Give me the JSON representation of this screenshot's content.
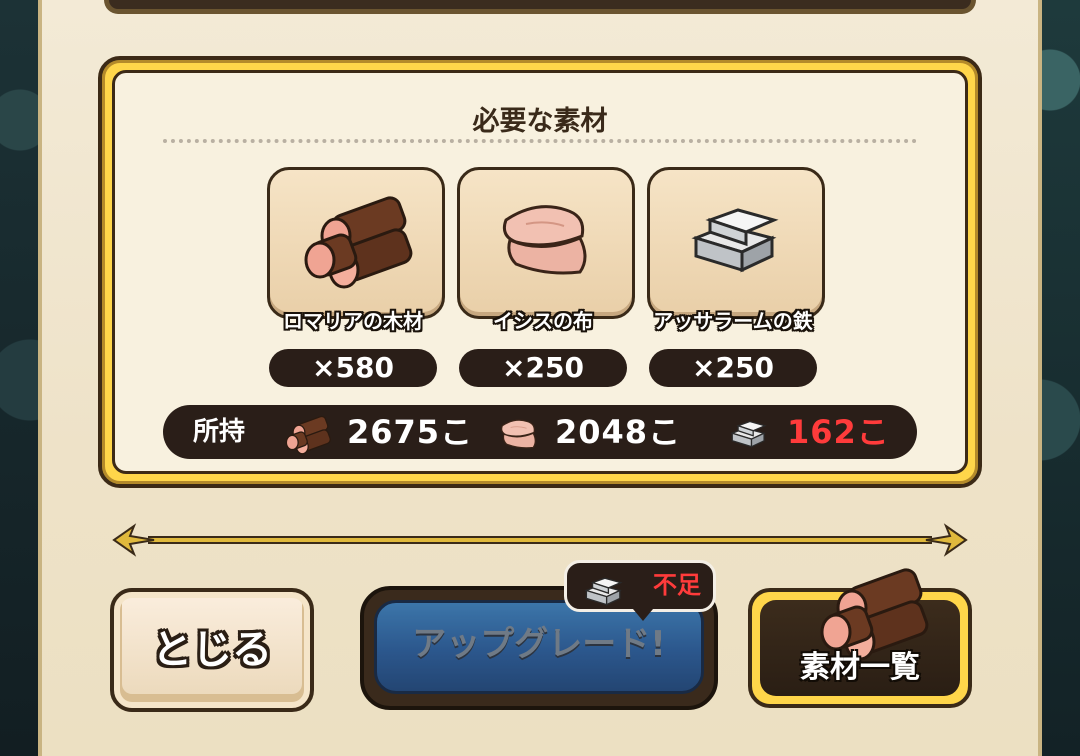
{
  "materials_panel": {
    "title": "必要な素材",
    "items": [
      {
        "name": "ロマリアの木材",
        "qty": "×580",
        "icon": "wood-logs-icon"
      },
      {
        "name": "イシスの布",
        "qty": "×250",
        "icon": "cloth-icon"
      },
      {
        "name": "アッサラームの鉄",
        "qty": "×250",
        "icon": "iron-ingot-icon"
      }
    ],
    "owned": {
      "label": "所持",
      "counts": [
        "2675こ",
        "2048こ",
        "162こ"
      ]
    }
  },
  "buttons": {
    "close": "とじる",
    "upgrade": "アップグレード!",
    "shortage": "不足",
    "material_list": "素材一覧"
  },
  "colors": {
    "panel_border": "#ffd64a",
    "shortage_red": "#ff3b3b",
    "upgrade_blue": "#2766b2"
  }
}
